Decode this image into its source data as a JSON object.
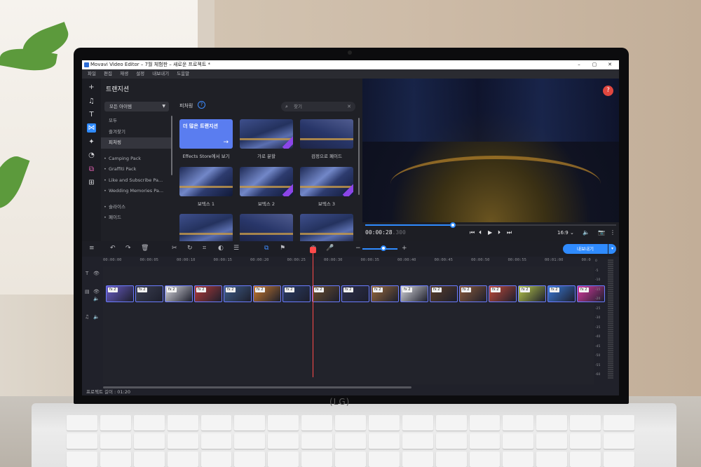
{
  "window": {
    "title": "Movavi Video Editor – 7월 체험판 – 새로운 프로젝트 *",
    "controls": [
      "–",
      "▢",
      "✕"
    ]
  },
  "menu": [
    "파일",
    "편집",
    "재생",
    "설정",
    "내보내기",
    "도움말"
  ],
  "left_tools": [
    "plus-icon",
    "music-note-icon",
    "text-icon",
    "transitions-icon",
    "magic-icon",
    "sticker-icon",
    "crop-icon",
    "more-tools-icon"
  ],
  "panel": {
    "title": "트랜지션",
    "filter_dropdown": "모든 아이템",
    "categories": [
      "모두",
      "즐겨찾기",
      "피처링"
    ],
    "packs": [
      "Camping Pack",
      "Graffiti Pack",
      "Like and Subscribe Pa...",
      "Wedding Memories Pa..."
    ],
    "more_categories": [
      "슬라이스",
      "페이드"
    ],
    "section_label": "피처링",
    "search_placeholder": "찾기",
    "more_tile_text": "더 많은 트랜지션",
    "tiles": [
      "Effects Store에서 보기",
      "가로 분할",
      "검정으로 페이드",
      "보텍스 1",
      "보텍스 2",
      "보텍스 3"
    ]
  },
  "preview": {
    "help": "?",
    "time_main": "00:00:28",
    "time_ms": ".300",
    "progress": 0.35,
    "aspect_ratio": "16:9"
  },
  "timeline": {
    "export_label": "내보내기",
    "ruler": [
      "00:00:00",
      "00:00:05",
      "00:00:10",
      "00:00:15",
      "00:00:20",
      "00:00:25",
      "00:00:30",
      "00:00:35",
      "00:00:40",
      "00:00:45",
      "00:00:50",
      "00:00:55",
      "00:01:00",
      "00:0"
    ],
    "clip_badge": "fx 2",
    "clip_count": 17,
    "zoom": 0.6,
    "meter_scale": [
      "0",
      "-5",
      "-10",
      "-15",
      "-20",
      "-25",
      "-30",
      "-35",
      "-40",
      "-45",
      "-50",
      "-55",
      "-60"
    ],
    "project_length_label": "프로젝트 길이 :",
    "project_length": "01:20"
  },
  "colors": {
    "accent": "#2f8bff",
    "playhead": "#ff4a4a",
    "help": "#e0473f",
    "panel_bg": "#1f2026"
  }
}
